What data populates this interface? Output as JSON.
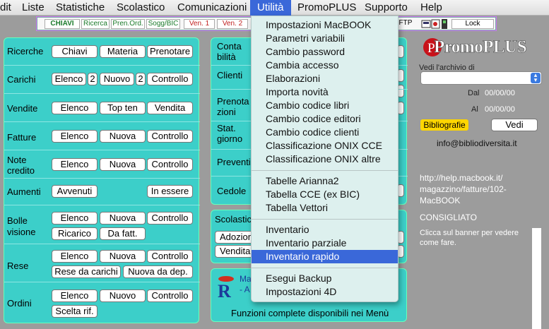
{
  "menubar": {
    "items": [
      "dit",
      "Liste",
      "Statistiche",
      "Scolastico",
      "Comunicazioni",
      "Utilità",
      "PromoPLUS",
      "Supporto",
      "Help"
    ]
  },
  "toolbar": {
    "items": [
      "CHIAVI",
      "Ricerca",
      "Pren.Ord.",
      "Sogg/BIC",
      "Ven. 1",
      "Ven. 2",
      "FTP",
      "Lock"
    ]
  },
  "left_panel": {
    "rows": [
      {
        "label": "Ricerche",
        "buttons": [
          "Chiavi",
          "Materia",
          "Prenotare"
        ]
      },
      {
        "label": "Carichi",
        "buttons": [
          "Elenco",
          "2",
          "Nuovo",
          "2",
          "Controllo"
        ]
      },
      {
        "label": "Vendite",
        "buttons": [
          "Elenco",
          "Top ten",
          "Vendita"
        ]
      },
      {
        "label": "Fatture",
        "buttons": [
          "Elenco",
          "Nuova",
          "Controllo"
        ]
      },
      {
        "label": "Note credito",
        "label1": "Note",
        "label2": "credito",
        "buttons": [
          "Elenco",
          "Nuova",
          "Controllo"
        ]
      },
      {
        "label": "Aumenti",
        "buttons": [
          "Avvenuti",
          "In essere"
        ]
      },
      {
        "label": "Bolle visione",
        "label1": "Bolle",
        "label2": "visione",
        "buttons": [
          "Elenco",
          "Nuova",
          "Controllo",
          "Ricarico",
          "Da fatt."
        ]
      },
      {
        "label": "Rese",
        "buttons": [
          "Elenco",
          "Nuova",
          "Controllo",
          "Rese da carichi",
          "Nuova da dep."
        ]
      },
      {
        "label": "Ordini",
        "buttons": [
          "Elenco",
          "Nuovo",
          "Controllo",
          "Scelta rif."
        ]
      }
    ]
  },
  "mid_panel": {
    "rows": [
      {
        "label1": "Conta",
        "label2": "bilità"
      },
      {
        "label1": "Clienti"
      },
      {
        "label1": "Prenota",
        "label2": "zioni"
      },
      {
        "label1": "Stat.",
        "label2": "giorno"
      },
      {
        "label1": "Preventi"
      },
      {
        "label1": "Cedole"
      }
    ],
    "scolastic": {
      "title": "Scolastic",
      "buttons": [
        "Adozion",
        "Vendita"
      ]
    },
    "banner": {
      "line1": "Ma",
      "line2": "- A",
      "footer": "Funzioni complete disponibili nei Menù"
    }
  },
  "dropdown": {
    "groups": [
      [
        "Impostazioni MacBOOK",
        "Parametri variabili",
        "Cambio password",
        "Cambia accesso",
        "Elaborazioni",
        "Importa novità",
        "Cambio codice libri",
        "Cambio codice editori",
        "Cambio codice clienti",
        "Classificazione ONIX CCE",
        "Classificazione ONIX altre"
      ],
      [
        "Tabelle Arianna2",
        "Tabella CCE (ex BIC)",
        "Tabella Vettori"
      ],
      [
        "Inventario",
        "Inventario parziale",
        "Inventario rapido"
      ],
      [
        "Esegui Backup",
        "Impostazioni 4D"
      ]
    ],
    "highlighted": "Inventario rapido"
  },
  "right": {
    "logo": "PromoPLUS",
    "archive_label": "Vedi l'archivio di",
    "dal_label": "Dal",
    "dal_value": "00/00/00",
    "al_label": "Al",
    "al_value": "00/00/00",
    "biblio_button": "Bibliografie",
    "vedi_button": "Vedi",
    "email": "info@bibliodiversita.it",
    "url1": "http://help.macbook.it/",
    "url2": "magazzino/fatture/102-",
    "url3": "MacBOOK",
    "consigliato": "CONSIGLIATO",
    "hint1": "Clicca sul banner per vedere",
    "hint2": "come fare."
  },
  "colors": {
    "panel": "#3ccfc9",
    "menu_highlight": "#3a68d9",
    "biblio": "#ffd600"
  }
}
